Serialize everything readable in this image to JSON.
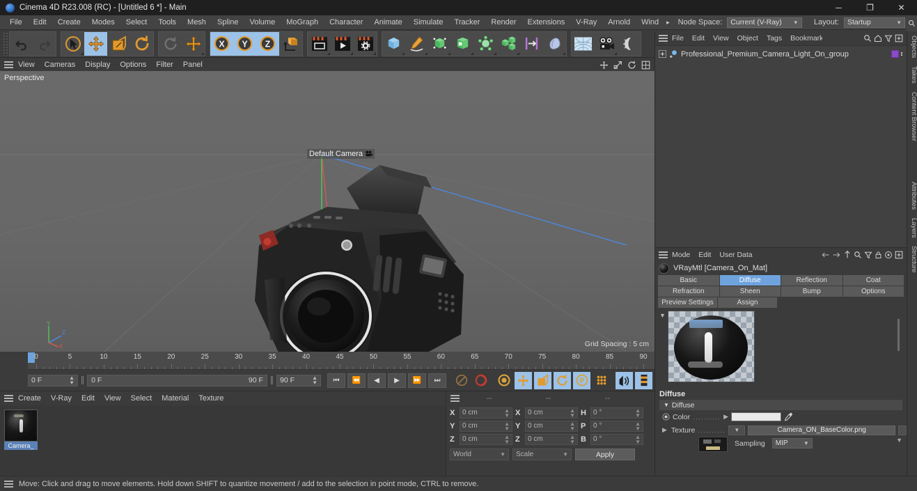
{
  "window": {
    "title": "Cinema 4D R23.008 (RC) - [Untitled 6 *] - Main",
    "minimize": "─",
    "maximize": "❐",
    "close": "✕"
  },
  "menubar": {
    "items": [
      "File",
      "Edit",
      "Create",
      "Modes",
      "Select",
      "Tools",
      "Mesh",
      "Spline",
      "Volume",
      "MoGraph",
      "Character",
      "Animate",
      "Simulate",
      "Tracker",
      "Render",
      "Extensions",
      "V-Ray",
      "Arnold",
      "Wind"
    ],
    "overflow_arrow": "▸",
    "node_space_label": "Node Space:",
    "node_space_value": "Current (V-Ray)",
    "layout_label": "Layout:",
    "layout_value": "Startup",
    "search_icon": "search-icon"
  },
  "toolbar": {
    "groups": [
      {
        "name": "history",
        "icons": [
          {
            "name": "undo-icon",
            "state": "normal"
          },
          {
            "name": "redo-icon",
            "state": "disabled"
          }
        ]
      },
      {
        "name": "modes",
        "icons": [
          {
            "name": "select-live-icon",
            "state": "normal"
          },
          {
            "name": "move-tool-icon",
            "state": "selected"
          },
          {
            "name": "scale-tool-icon",
            "state": "normal"
          },
          {
            "name": "rotate-tool-icon",
            "state": "normal"
          }
        ]
      },
      {
        "name": "axis-lock",
        "icons": [
          {
            "name": "undo-view-icon",
            "state": "disabled"
          },
          {
            "name": "move-axis-icon",
            "state": "normal"
          }
        ]
      },
      {
        "name": "axes",
        "icons": [
          {
            "name": "x-axis-icon",
            "state": "selected"
          },
          {
            "name": "y-axis-icon",
            "state": "selected"
          },
          {
            "name": "z-axis-icon",
            "state": "selected"
          },
          {
            "name": "world-object-axis-icon",
            "state": "normal"
          }
        ]
      },
      {
        "name": "render",
        "icons": [
          {
            "name": "render-view-icon",
            "state": "normal"
          },
          {
            "name": "render-to-picture-viewer-icon",
            "state": "normal"
          },
          {
            "name": "render-settings-icon",
            "state": "normal"
          }
        ]
      },
      {
        "name": "objects",
        "icons": [
          {
            "name": "cube-primitive-icon",
            "state": "normal"
          },
          {
            "name": "pen-spline-icon",
            "state": "normal"
          },
          {
            "name": "nurbs-generator-icon",
            "state": "normal"
          },
          {
            "name": "array-generator-icon",
            "state": "normal"
          },
          {
            "name": "deformer-icon",
            "state": "normal"
          },
          {
            "name": "mograph-cloner-icon",
            "state": "normal"
          },
          {
            "name": "field-icon",
            "state": "normal"
          },
          {
            "name": "effector-icon",
            "state": "normal"
          },
          {
            "name": "environment-sky-icon",
            "state": "normal"
          },
          {
            "name": "camera-icon",
            "state": "normal"
          },
          {
            "name": "light-icon",
            "state": "normal"
          }
        ]
      }
    ]
  },
  "viewport": {
    "menu": [
      "View",
      "Cameras",
      "Display",
      "Options",
      "Filter",
      "Panel"
    ],
    "label": "Perspective",
    "camera_label": "Default Camera",
    "grid_spacing": "Grid Spacing : 5 cm",
    "axis": {
      "x": "X",
      "y": "Y",
      "z": "Z"
    },
    "tool_icons": [
      "undo-view-icon",
      "move-camera-icon",
      "scale-camera-icon",
      "rotate-camera-icon",
      "maximize-viewport-icon"
    ]
  },
  "left_rail": {
    "icons": [
      "texture-axis-icon",
      "point-mode-icon",
      "edge-mode-icon",
      "polygon-mode-icon",
      "model-mode-icon",
      "object-axis-icon",
      "texture-mode-icon",
      "workplane-icon",
      "enable-axis-icon",
      "enable-snap-icon",
      "quantize-icon",
      "lock-icon",
      "viewport-solo-icon",
      "deformer-enable-icon",
      "selection-filter-icon",
      "layer-icon"
    ]
  },
  "timeline": {
    "ruler_ticks": [
      0,
      5,
      10,
      15,
      20,
      25,
      30,
      35,
      40,
      45,
      50,
      55,
      60,
      65,
      70,
      75,
      80,
      85,
      90
    ],
    "current_frame": "0 F",
    "range_start": "0 F",
    "range_end": "90 F",
    "preview_start": "0 F",
    "preview_end": "90 F",
    "max_frame": "90 F",
    "transport": [
      "go-to-start-icon",
      "step-back-icon",
      "play-back-icon",
      "play-forward-icon",
      "step-forward-icon",
      "go-to-end-icon"
    ],
    "record_icons": [
      "autokey-icon",
      "record-active-objects-icon"
    ],
    "key_icons": [
      "keyframe-selection-icon",
      "position-key-icon",
      "scale-key-icon",
      "rotation-key-icon",
      "parameter-key-icon",
      "point-level-animation-icon"
    ],
    "extra_icons": [
      "sound-icon",
      "timeline-icon"
    ]
  },
  "material_manager": {
    "menu": [
      "Create",
      "V-Ray",
      "Edit",
      "View",
      "Select",
      "Material",
      "Texture"
    ],
    "materials": [
      {
        "name": "Camera_",
        "thumbnail": "dark-glossy-sphere",
        "selected": true
      }
    ]
  },
  "coordinates": {
    "headers": [
      "--",
      "--",
      "--"
    ],
    "rows": [
      {
        "pos_label": "X",
        "pos_value": "0 cm",
        "size_label": "X",
        "size_value": "0 cm",
        "rot_label": "H",
        "rot_value": "0 °"
      },
      {
        "pos_label": "Y",
        "pos_value": "0 cm",
        "size_label": "Y",
        "size_value": "0 cm",
        "rot_label": "P",
        "rot_value": "0 °"
      },
      {
        "pos_label": "Z",
        "pos_value": "0 cm",
        "size_label": "Z",
        "size_value": "0 cm",
        "rot_label": "B",
        "rot_value": "0 °"
      }
    ],
    "system": "World",
    "mode": "Scale",
    "apply": "Apply"
  },
  "object_manager": {
    "menu": [
      "File",
      "Edit",
      "View",
      "Object",
      "Tags",
      "Bookmarks"
    ],
    "icons": [
      "search-icon",
      "home-icon",
      "filter-icon",
      "add-icon"
    ],
    "objects": [
      {
        "name": "Professional_Premium_Camera_Light_On_group",
        "icon": "null-object-icon",
        "tag_color": "#8b4bc4"
      }
    ]
  },
  "attributes": {
    "menu": [
      "Mode",
      "Edit",
      "User Data"
    ],
    "nav_icons": [
      "back-arrow-icon",
      "forward-arrow-icon",
      "up-arrow-icon",
      "search-icon",
      "filter-icon",
      "lock-icon",
      "target-icon",
      "add-icon"
    ],
    "title": "VRayMtl [Camera_On_Mat]",
    "tabs_row1": [
      {
        "label": "Basic",
        "active": false
      },
      {
        "label": "Diffuse",
        "active": true
      },
      {
        "label": "Reflection",
        "active": false
      },
      {
        "label": "Coat",
        "active": false
      }
    ],
    "tabs_row2": [
      {
        "label": "Refraction",
        "active": false
      },
      {
        "label": "Sheen",
        "active": false
      },
      {
        "label": "Bump",
        "active": false
      },
      {
        "label": "Options",
        "active": false
      }
    ],
    "tabs_row3": [
      {
        "label": "Preview Settings",
        "active": false
      },
      {
        "label": "Assign",
        "active": false
      }
    ],
    "section_title": "Diffuse",
    "group_title": "Diffuse",
    "color_label": "Color",
    "color_value": "#e8e8e8",
    "color_picker_icon": "eyedropper-icon",
    "texture_label": "Texture",
    "texture_value": "Camera_ON_BaseColor.png",
    "sampling_label": "Sampling",
    "sampling_value": "MIP"
  },
  "side_tabs": {
    "top": [
      "Objects",
      "Takes",
      "Content Browser"
    ],
    "bottom": [
      "Attributes",
      "Layers",
      "Structure"
    ],
    "search_icon": "search-icon"
  },
  "statusbar": {
    "text": "Move: Click and drag to move elements. Hold down SHIFT to quantize movement / add to the selection in point mode, CTRL to remove."
  }
}
